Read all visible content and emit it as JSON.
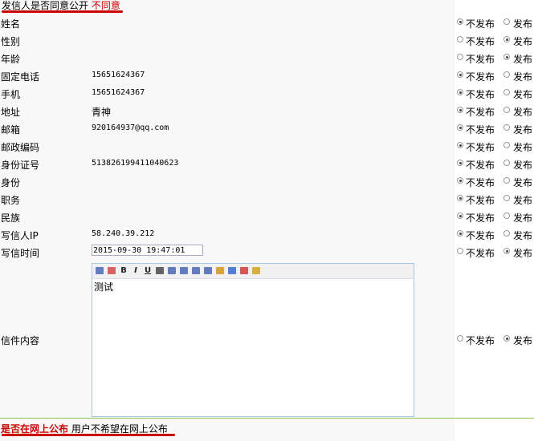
{
  "header": {
    "question": "发信人是否同意公开",
    "answer": "不同意"
  },
  "options": {
    "no_publish": "不发布",
    "publish": "发布"
  },
  "fields": [
    {
      "label": "姓名",
      "value": "",
      "publish": false
    },
    {
      "label": "性别",
      "value": "",
      "publish": true
    },
    {
      "label": "年龄",
      "value": "",
      "publish": true
    },
    {
      "label": "固定电话",
      "value": "15651624367",
      "publish": false
    },
    {
      "label": "手机",
      "value": "15651624367",
      "publish": false
    },
    {
      "label": "地址",
      "value": "青神",
      "publish": false
    },
    {
      "label": "邮箱",
      "value": "920164937@qq.com",
      "publish": false
    },
    {
      "label": "邮政编码",
      "value": "",
      "publish": false
    },
    {
      "label": "身份证号",
      "value": "513826199411040623",
      "publish": false
    },
    {
      "label": "身份",
      "value": "",
      "publish": false
    },
    {
      "label": "职务",
      "value": "",
      "publish": false
    },
    {
      "label": "民族",
      "value": "",
      "publish": false
    },
    {
      "label": "写信人IP",
      "value": "58.240.39.212",
      "publish": false
    },
    {
      "label": "写信时间",
      "value": "2015-09-30 19:47:01",
      "publish": true
    }
  ],
  "letter": {
    "label": "信件内容",
    "content": "测试",
    "publish": true
  },
  "toolbar_icons": [
    "spellcheck-icon",
    "font-color-icon",
    "bold-icon",
    "italic-icon",
    "underline-icon",
    "align-icon",
    "ordered-list-icon",
    "outdent-icon",
    "indent-icon",
    "text-size-icon",
    "background-color-icon",
    "link-icon",
    "unlink-icon",
    "image-icon"
  ],
  "toolbar_glyphs": {
    "bold": "B",
    "italic": "I",
    "underline": "U"
  },
  "footer": {
    "question": "是否在网上公布",
    "answer": "用户不希望在网上公布"
  },
  "colors": {
    "accent_red": "#cc0000",
    "divider_green": "#8bc34a",
    "editor_border": "#a8c8e8"
  }
}
